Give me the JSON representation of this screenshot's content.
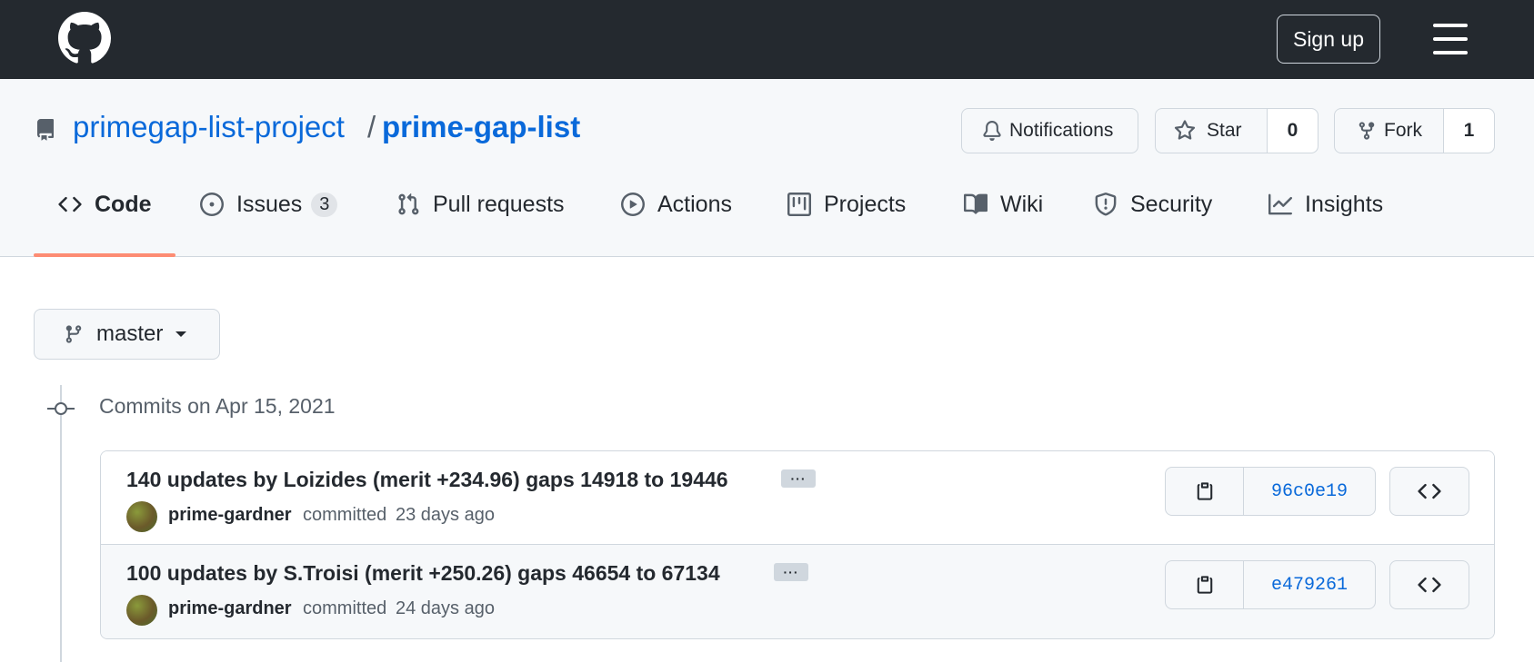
{
  "header": {
    "logo_icon": "github-mark-icon",
    "signup_label": "Sign up",
    "menu_icon": "hamburger-icon"
  },
  "repo": {
    "owner": "primegap-list-project",
    "separator": "/",
    "name": "prime-gap-list",
    "notifications_label": "Notifications",
    "star_label": "Star",
    "star_count": "0",
    "fork_label": "Fork",
    "fork_count": "1"
  },
  "tabs": [
    {
      "label": "Code",
      "icon": "code-icon",
      "selected": true
    },
    {
      "label": "Issues",
      "icon": "issue-opened-icon",
      "counter": "3"
    },
    {
      "label": "Pull requests",
      "icon": "git-pull-request-icon"
    },
    {
      "label": "Actions",
      "icon": "play-icon"
    },
    {
      "label": "Projects",
      "icon": "project-icon"
    },
    {
      "label": "Wiki",
      "icon": "book-icon"
    },
    {
      "label": "Security",
      "icon": "shield-icon"
    },
    {
      "label": "Insights",
      "icon": "graph-icon"
    }
  ],
  "branch": {
    "name": "master"
  },
  "commit_group": {
    "date_heading": "Commits on Apr 15, 2021"
  },
  "commits": [
    {
      "title": "140 updates by Loizides (merit +234.96) gaps 14918 to 19446",
      "ellipsis": "···",
      "author": "prime-gardner",
      "action": "committed",
      "when": "23 days ago",
      "sha": "96c0e19"
    },
    {
      "title": "100 updates by S.Troisi (merit +250.26) gaps 46654 to 67134",
      "ellipsis": "···",
      "author": "prime-gardner",
      "action": "committed",
      "when": "24 days ago",
      "sha": "e479261"
    }
  ],
  "colors": {
    "header_bg": "#24292f",
    "link": "#0969da",
    "tab_underline": "#fd8c73",
    "border": "#d0d7de"
  }
}
